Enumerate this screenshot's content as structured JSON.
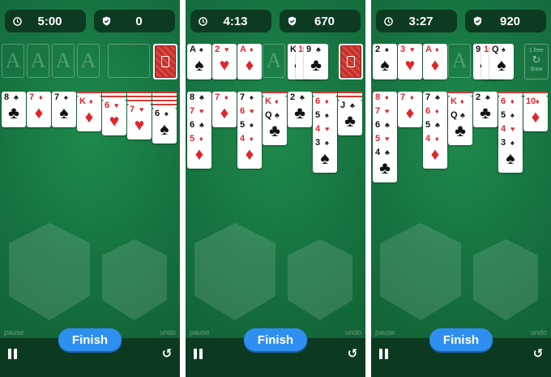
{
  "panels": [
    {
      "timer": "5:00",
      "score": "0",
      "foundations": [
        {
          "type": "empty",
          "letter": "A"
        },
        {
          "type": "empty",
          "letter": "A"
        },
        {
          "type": "empty",
          "letter": "A"
        },
        {
          "type": "empty",
          "letter": "A"
        }
      ],
      "stock": "deck",
      "tableau": [
        {
          "backs": 0,
          "cards": [
            {
              "rank": "8",
              "suit": "♣",
              "color": "black"
            }
          ]
        },
        {
          "backs": 0,
          "cards": [
            {
              "rank": "7",
              "suit": "♦",
              "color": "red"
            }
          ]
        },
        {
          "backs": 0,
          "cards": [
            {
              "rank": "7",
              "suit": "♠",
              "color": "black"
            }
          ]
        },
        {
          "backs": 1,
          "cards": [
            {
              "rank": "K",
              "suit": "♦",
              "color": "red"
            }
          ]
        },
        {
          "backs": 2,
          "cards": [
            {
              "rank": "6",
              "suit": "♥",
              "color": "red"
            }
          ]
        },
        {
          "backs": 3,
          "cards": [
            {
              "rank": "7",
              "suit": "♥",
              "color": "red"
            }
          ]
        },
        {
          "backs": 4,
          "cards": [
            {
              "rank": "6",
              "suit": "♠",
              "color": "black"
            }
          ]
        }
      ]
    },
    {
      "timer": "4:13",
      "score": "670",
      "foundations": [
        {
          "type": "card",
          "rank": "A",
          "suit": "♠",
          "color": "black"
        },
        {
          "type": "card",
          "rank": "2",
          "suit": "♥",
          "color": "red"
        },
        {
          "type": "card",
          "rank": "A",
          "suit": "♦",
          "color": "red"
        },
        {
          "type": "empty",
          "letter": "A"
        }
      ],
      "waste": [
        {
          "rank": "K",
          "suit": "♣",
          "color": "black"
        },
        {
          "rank": "10",
          "suit": "♥",
          "color": "red"
        },
        {
          "rank": "9",
          "suit": "♣",
          "color": "black"
        }
      ],
      "stock": "deck",
      "tableau": [
        {
          "backs": 0,
          "cards": [
            {
              "rank": "8",
              "suit": "♣",
              "color": "black"
            },
            {
              "rank": "7",
              "suit": "♥",
              "color": "red"
            },
            {
              "rank": "6",
              "suit": "♣",
              "color": "black"
            },
            {
              "rank": "5",
              "suit": "♦",
              "color": "red"
            }
          ]
        },
        {
          "backs": 0,
          "cards": [
            {
              "rank": "7",
              "suit": "♦",
              "color": "red"
            }
          ]
        },
        {
          "backs": 0,
          "cards": [
            {
              "rank": "7",
              "suit": "♠",
              "color": "black"
            },
            {
              "rank": "6",
              "suit": "♥",
              "color": "red"
            },
            {
              "rank": "5",
              "suit": "♠",
              "color": "black"
            },
            {
              "rank": "4",
              "suit": "♦",
              "color": "red"
            }
          ]
        },
        {
          "backs": 1,
          "cards": [
            {
              "rank": "K",
              "suit": "♦",
              "color": "red"
            },
            {
              "rank": "Q",
              "suit": "♣",
              "color": "black"
            }
          ]
        },
        {
          "backs": 0,
          "cards": [
            {
              "rank": "2",
              "suit": "♣",
              "color": "black"
            }
          ]
        },
        {
          "backs": 1,
          "cards": [
            {
              "rank": "6",
              "suit": "♦",
              "color": "red"
            },
            {
              "rank": "5",
              "suit": "♠",
              "color": "black"
            },
            {
              "rank": "4",
              "suit": "♥",
              "color": "red"
            },
            {
              "rank": "3",
              "suit": "♠",
              "color": "black"
            }
          ]
        },
        {
          "backs": 2,
          "cards": [
            {
              "rank": "J",
              "suit": "♣",
              "color": "black"
            }
          ]
        }
      ]
    },
    {
      "timer": "3:27",
      "score": "920",
      "foundations": [
        {
          "type": "card",
          "rank": "2",
          "suit": "♠",
          "color": "black"
        },
        {
          "type": "card",
          "rank": "3",
          "suit": "♥",
          "color": "red"
        },
        {
          "type": "card",
          "rank": "A",
          "suit": "♦",
          "color": "red"
        },
        {
          "type": "empty",
          "letter": "A"
        }
      ],
      "waste": [
        {
          "rank": "9",
          "suit": "♣",
          "color": "black"
        },
        {
          "rank": "10",
          "suit": "♥",
          "color": "red"
        },
        {
          "rank": "Q",
          "suit": "♠",
          "color": "black"
        }
      ],
      "stock": "redeal",
      "redeal_line1": "1 free",
      "redeal_line2": "draw",
      "tableau": [
        {
          "backs": 0,
          "cards": [
            {
              "rank": "8",
              "suit": "♦",
              "color": "red"
            },
            {
              "rank": "7",
              "suit": "♥",
              "color": "red"
            },
            {
              "rank": "6",
              "suit": "♣",
              "color": "black"
            },
            {
              "rank": "5",
              "suit": "♥",
              "color": "red"
            },
            {
              "rank": "4",
              "suit": "♣",
              "color": "black"
            }
          ]
        },
        {
          "backs": 0,
          "cards": [
            {
              "rank": "7",
              "suit": "♦",
              "color": "red"
            }
          ]
        },
        {
          "backs": 0,
          "cards": [
            {
              "rank": "7",
              "suit": "♣",
              "color": "black"
            },
            {
              "rank": "6",
              "suit": "♦",
              "color": "red"
            },
            {
              "rank": "5",
              "suit": "♣",
              "color": "black"
            },
            {
              "rank": "4",
              "suit": "♦",
              "color": "red"
            }
          ]
        },
        {
          "backs": 1,
          "cards": [
            {
              "rank": "K",
              "suit": "♦",
              "color": "red"
            },
            {
              "rank": "Q",
              "suit": "♣",
              "color": "black"
            }
          ]
        },
        {
          "backs": 0,
          "cards": [
            {
              "rank": "2",
              "suit": "♣",
              "color": "black"
            }
          ]
        },
        {
          "backs": 1,
          "cards": [
            {
              "rank": "6",
              "suit": "♦",
              "color": "red"
            },
            {
              "rank": "5",
              "suit": "♠",
              "color": "black"
            },
            {
              "rank": "4",
              "suit": "♥",
              "color": "red"
            },
            {
              "rank": "3",
              "suit": "♠",
              "color": "black"
            }
          ]
        },
        {
          "backs": 1,
          "cards": [
            {
              "rank": "10",
              "suit": "♦",
              "color": "red"
            }
          ]
        }
      ]
    }
  ],
  "controls": {
    "pause_label": "pause",
    "undo_label": "undo",
    "finish_label": "Finish"
  },
  "icons": {
    "timer": "clock-icon",
    "score": "shield-check-icon",
    "pause": "pause-icon",
    "undo": "undo-icon"
  },
  "colors": {
    "felt": "#167240",
    "hud": "#0d3b22",
    "finish": "#2f8ff0",
    "red_suit": "#e0262d"
  }
}
